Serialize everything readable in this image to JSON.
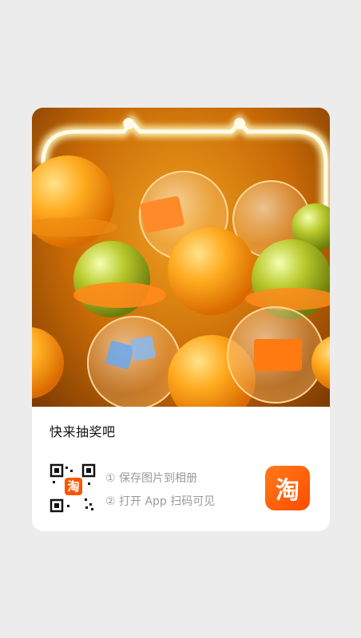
{
  "card": {
    "title": "快来抽奖吧",
    "steps": [
      "① 保存图片到相册",
      "② 打开 App 扫码可见"
    ],
    "app_icon": {
      "name": "taobao-app-icon",
      "glyph": "淘",
      "color": "#ff5500"
    },
    "qr_badge_glyph": "淘"
  },
  "colors": {
    "background": "#ececec",
    "card": "#ffffff",
    "accent": "#ff5500",
    "muted_text": "#9a9a9a"
  }
}
